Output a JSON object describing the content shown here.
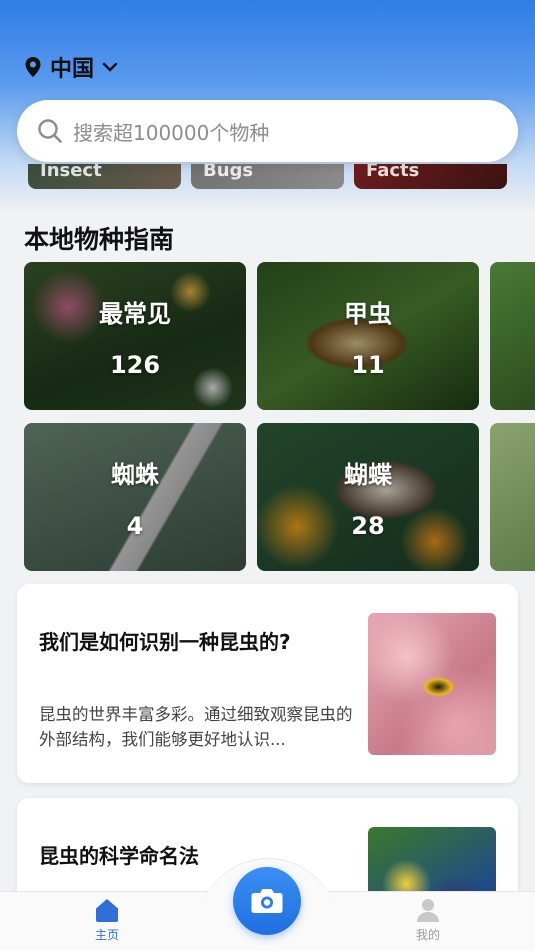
{
  "header": {
    "location": "中国",
    "search_placeholder": "搜索超100000个物种"
  },
  "peek_cards": [
    {
      "label": "Insect"
    },
    {
      "label": "Bugs"
    },
    {
      "label": "Facts"
    }
  ],
  "guide": {
    "title": "本地物种指南",
    "cards": [
      {
        "name": "最常见",
        "count": "126"
      },
      {
        "name": "甲虫",
        "count": "11"
      },
      {
        "name": "蜘蛛",
        "count": "4"
      },
      {
        "name": "蝴蝶",
        "count": "28"
      }
    ]
  },
  "articles": [
    {
      "title": "我们是如何识别一种昆虫的?",
      "excerpt": "昆虫的世界丰富多彩。通过细致观察昆虫的外部结构，我们能够更好地认识..."
    },
    {
      "title": "昆虫的科学命名法",
      "excerpt": ""
    }
  ],
  "tabbar": {
    "home_label": "主页",
    "me_label": "我的"
  },
  "colors": {
    "accent": "#1f6fe0",
    "hero_top": "#2f7de6"
  }
}
